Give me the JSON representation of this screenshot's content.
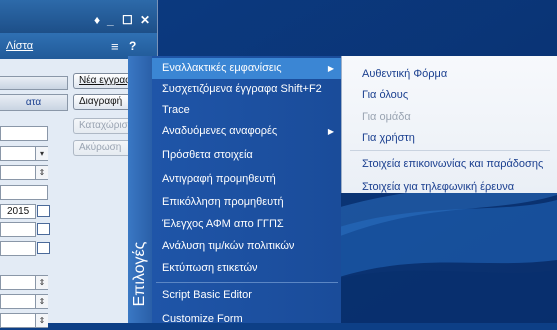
{
  "window": {
    "controls": [
      "♦",
      "_",
      "☐",
      "✕"
    ],
    "toolbar_link": "Λίστα",
    "tab_label": "ατα"
  },
  "buttons": [
    {
      "label": "Νέα εγγραφ",
      "disabled": false
    },
    {
      "label": "Διαγραφή",
      "disabled": false
    },
    {
      "label": "Καταχώρισ",
      "disabled": true
    },
    {
      "label": "Ακύρωση",
      "disabled": true
    }
  ],
  "fields": {
    "date_value": "2015"
  },
  "sidebar_title": "Επιλογές",
  "menu": [
    {
      "label": "Εναλλακτικές εμφανίσεις",
      "submenu": true,
      "highlighted": true
    },
    {
      "label": "Συσχετιζόμενα έγγραφα  Shift+F2",
      "submenu": false
    },
    {
      "label": "Trace",
      "submenu": false
    },
    {
      "label": "Αναδυόμενες αναφορές",
      "submenu": true
    },
    {
      "label": "Πρόσθετα στοιχεία",
      "submenu": false
    },
    {
      "label": "Αντιγραφή προμηθευτή",
      "submenu": false
    },
    {
      "label": "Επικόλληση προμηθευτή",
      "submenu": false
    },
    {
      "label": "Έλεγχος ΑΦΜ απο ΓΓΠΣ",
      "submenu": false
    },
    {
      "label": "Ανάλυση τιμ/κών πολιτικών",
      "submenu": false
    },
    {
      "label": "Εκτύπωση ετικετών",
      "submenu": false
    },
    {
      "label": "Script Basic Editor",
      "submenu": false
    },
    {
      "label": "Customize Form",
      "submenu": false
    }
  ],
  "submenu": [
    {
      "label": "Αυθεντική Φόρμα",
      "disabled": false
    },
    {
      "label": "Για όλους",
      "disabled": false
    },
    {
      "label": "Για ομάδα",
      "disabled": true
    },
    {
      "label": "Για χρήστη",
      "disabled": false
    },
    {
      "label": "Στοιχεία επικοινωνίας και παράδοσης",
      "disabled": false
    },
    {
      "label": "Στοιχεία για τηλεφωνική έρευνα",
      "disabled": false
    }
  ],
  "colors": {
    "menu_bg": "#1a4c9a",
    "menu_highlight": "#3b86d4",
    "submenu_text": "#1a3f8f"
  }
}
